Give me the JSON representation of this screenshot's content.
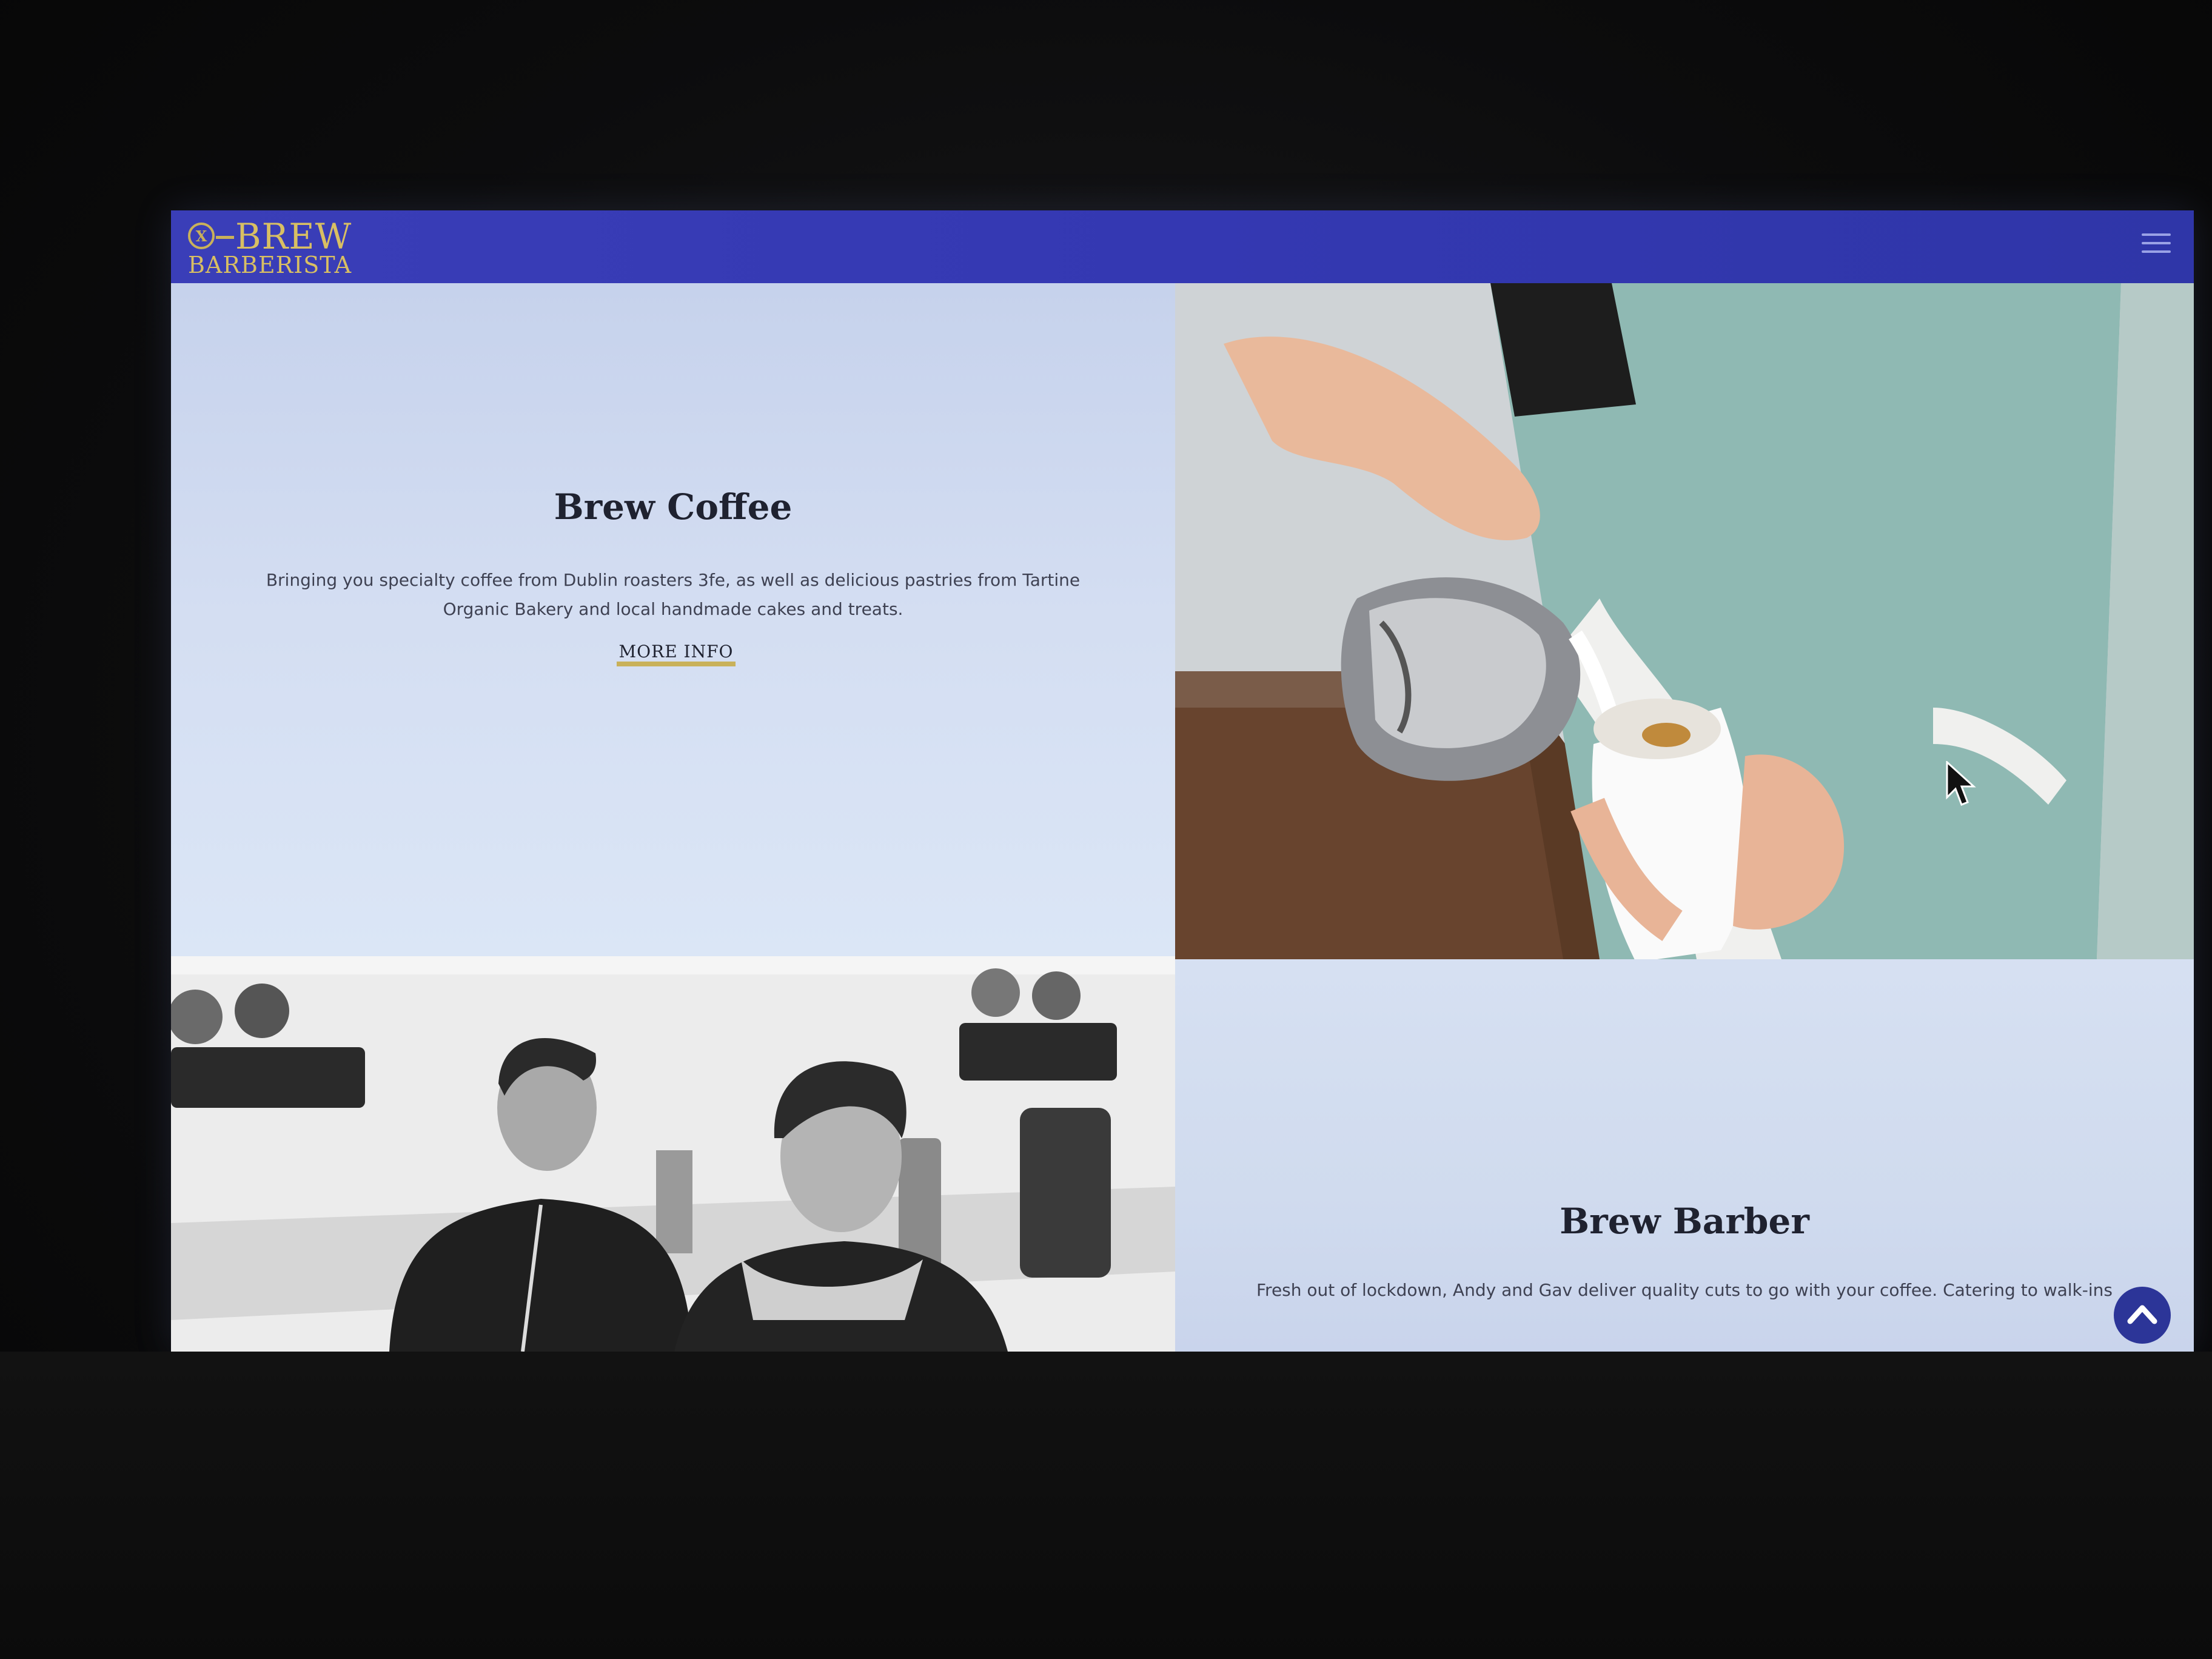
{
  "navbar": {
    "logo_mark": "X",
    "logo_text": "BREW",
    "logo_subtext": "BARBERISTA",
    "menu_icon": "hamburger-menu-icon",
    "color": "#3a3eb8",
    "logo_color": "#d8bf63"
  },
  "coffee": {
    "title": "Brew Coffee",
    "description": "Bringing you specialty coffee from Dublin roasters 3fe, as well as delicious pastries from Tartine Organic Bakery and local handmade cakes and treats.",
    "more_info_label": "MORE INFO",
    "accent": "#c9b15a"
  },
  "barber": {
    "title": "Brew Barber",
    "description": "Fresh out of lockdown, Andy and Gav deliver quality cuts to go with your coffee. Catering to walk-ins"
  },
  "scroll_top_icon": "chevron-up-icon",
  "pointer_icon": "mouse-cursor-icon"
}
